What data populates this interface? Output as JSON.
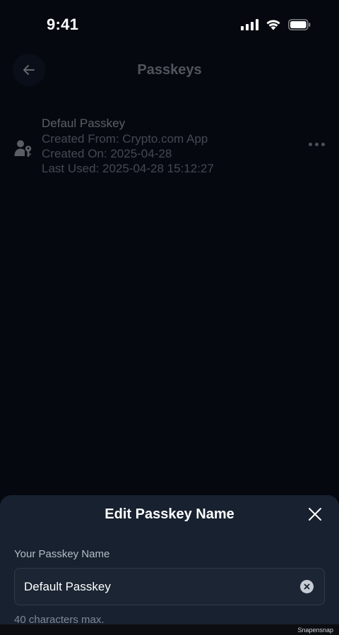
{
  "status_bar": {
    "time": "9:41"
  },
  "header": {
    "title": "Passkeys",
    "back_icon": "arrow-left-icon"
  },
  "passkeys": [
    {
      "name": "Defaul Passkey",
      "created_from": "Created From: Crypto.com App",
      "created_on": "Created On: 2025-04-28",
      "last_used": "Last Used: 2025-04-28 15:12:27",
      "icon": "user-key-icon",
      "menu_icon": "more-horizontal-icon"
    }
  ],
  "sheet": {
    "title": "Edit Passkey Name",
    "field_label": "Your Passkey Name",
    "input_value": "Default Passkey",
    "hint": "40 characters max.",
    "close_icon": "close-icon",
    "clear_icon": "clear-input-icon"
  },
  "watermark": "Snapensnap",
  "colors": {
    "background": "#05080f",
    "sheet": "#17212f",
    "input_border": "#2f3b4b"
  }
}
